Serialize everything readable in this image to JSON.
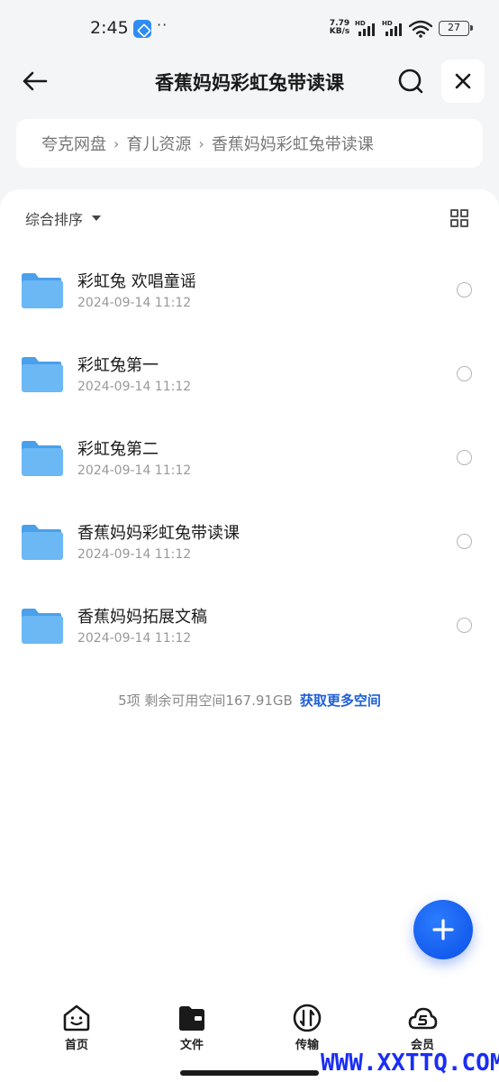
{
  "status_bar": {
    "time": "2:45",
    "dots": "··",
    "speed_value": "7.79",
    "speed_unit": "KB/s",
    "sim1_label": "HD",
    "sim2_label": "HD",
    "battery": "27"
  },
  "header": {
    "title": "香蕉妈妈彩虹兔带读课"
  },
  "breadcrumb": [
    "夸克网盘",
    "育儿资源",
    "香蕉妈妈彩虹兔带读课"
  ],
  "breadcrumb_separator": "›",
  "toolbar": {
    "sort_label": "综合排序"
  },
  "files": [
    {
      "name": "彩虹兔 欢唱童谣",
      "date": "2024-09-14 11:12"
    },
    {
      "name": "彩虹兔第一",
      "date": "2024-09-14 11:12"
    },
    {
      "name": "彩虹兔第二",
      "date": "2024-09-14 11:12"
    },
    {
      "name": "香蕉妈妈彩虹兔带读课",
      "date": "2024-09-14 11:12"
    },
    {
      "name": "香蕉妈妈拓展文稿",
      "date": "2024-09-14 11:12"
    }
  ],
  "summary": {
    "text": "5项 剩余可用空间167.91GB",
    "link": "获取更多空间"
  },
  "nav": {
    "home": "首页",
    "files": "文件",
    "transfer": "传输",
    "vip": "会员"
  },
  "watermark": "WWW.XXTTQ.COM",
  "colors": {
    "accent": "#1e5fd8",
    "fab": "#1456f0",
    "folder": "#5aaef0"
  }
}
